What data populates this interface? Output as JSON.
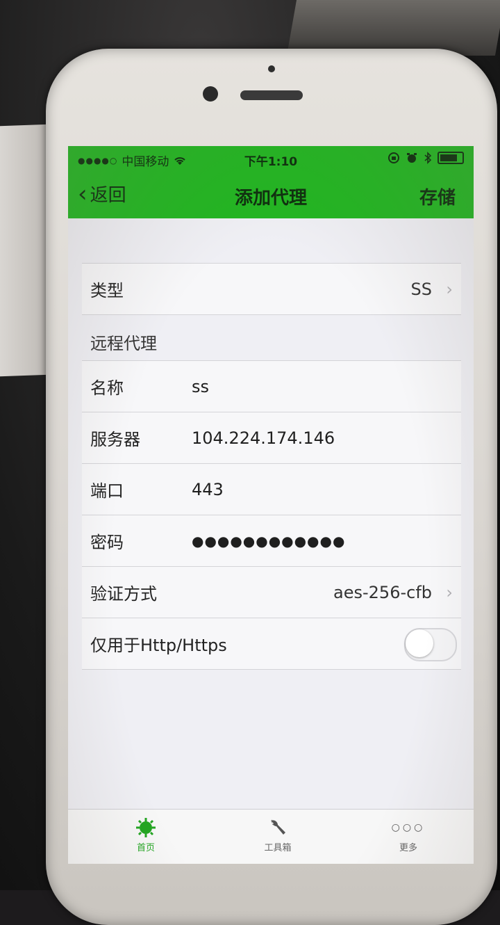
{
  "status_bar": {
    "carrier": "中国移动",
    "time": "下午1:10"
  },
  "nav": {
    "back_label": "返回",
    "title": "添加代理",
    "save_label": "存储"
  },
  "type_row": {
    "label": "类型",
    "value": "SS"
  },
  "section_header": "远程代理",
  "fields": [
    {
      "label": "名称",
      "value": "ss"
    },
    {
      "label": "服务器",
      "value": "104.224.174.146"
    },
    {
      "label": "端口",
      "value": "443"
    },
    {
      "label": "密码",
      "value": "●●●●●●●●●●●●"
    }
  ],
  "auth_row": {
    "label": "验证方式",
    "value": "aes-256-cfb"
  },
  "http_only_row": {
    "label": "仅用于Http/Https",
    "enabled": false
  },
  "tab_bar": {
    "tabs": [
      {
        "label": "首页",
        "icon": "gear-bug-icon",
        "active": true
      },
      {
        "label": "工具箱",
        "icon": "wrench-icon",
        "active": false
      },
      {
        "label": "更多",
        "icon": "more-dots-icon",
        "active": false
      }
    ]
  },
  "colors": {
    "accent": "#22b521",
    "background": "#efeff4"
  }
}
